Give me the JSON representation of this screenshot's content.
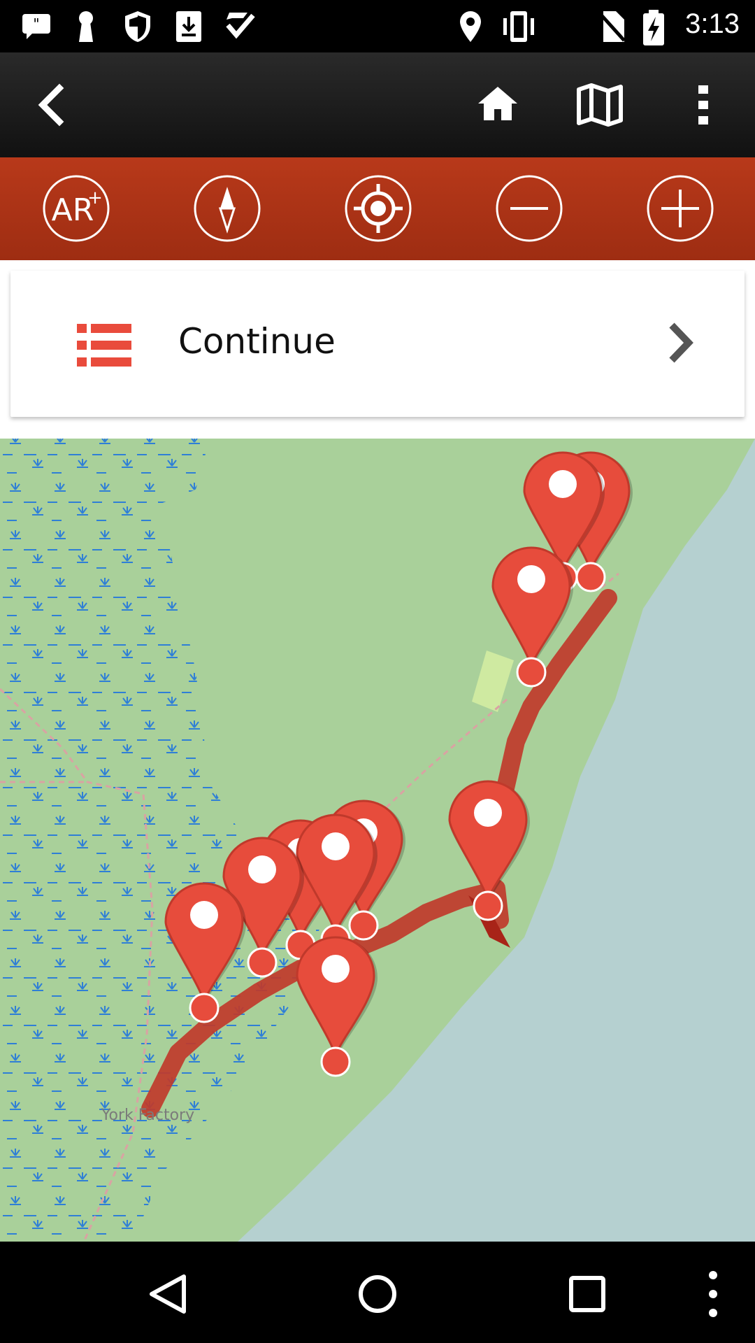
{
  "status_bar": {
    "time": "3:13",
    "left_icons": [
      "quote-bubble-icon",
      "keyhole-icon",
      "shield-icon",
      "download-icon",
      "check-icon"
    ],
    "right_icons": [
      "location-pin-icon",
      "vibrate-icon",
      "no-sim-icon",
      "battery-charging-icon"
    ]
  },
  "top_bar": {
    "back_icon": "chevron-left-icon",
    "actions": [
      "home-icon",
      "map-icon",
      "overflow-menu-icon"
    ]
  },
  "tool_bar": {
    "buttons": [
      "ar-plus-icon",
      "compass-icon",
      "locate-icon",
      "zoom-out-icon",
      "zoom-in-icon"
    ],
    "accent_color": "#a9351a"
  },
  "continue_card": {
    "label": "Continue",
    "icon": "list-icon",
    "icon_color": "#e94b3c",
    "chevron": "chevron-right-icon"
  },
  "map": {
    "place_label": "York Factory",
    "land_color": "#a9d09a",
    "water_color": "#b5d0d0",
    "route_color": "#c0392b",
    "marker_color": "#e74c3c",
    "marker_count": 12
  },
  "nav_bar": {
    "buttons": [
      "back-triangle-icon",
      "home-circle-icon",
      "recents-square-icon",
      "more-dots-icon"
    ]
  }
}
